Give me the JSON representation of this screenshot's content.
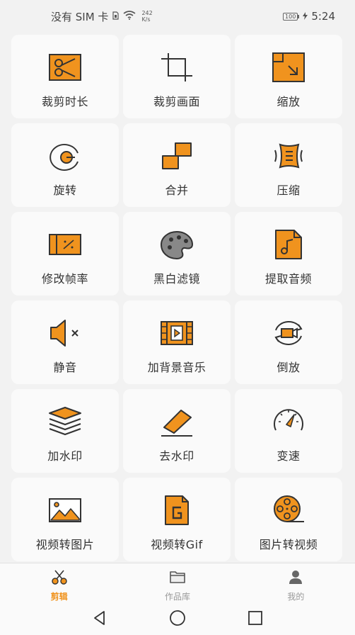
{
  "status_bar": {
    "carrier": "没有 SIM 卡",
    "net_speed_value": "242",
    "net_speed_unit": "K/s",
    "battery": "100",
    "time": "5:24"
  },
  "colors": {
    "accent": "#f0931e",
    "icon_stroke": "#333333",
    "tile_bg": "#fafafa"
  },
  "tools": [
    {
      "label": "裁剪时长",
      "icon": "scissors-icon"
    },
    {
      "label": "裁剪画面",
      "icon": "crop-icon"
    },
    {
      "label": "缩放",
      "icon": "scale-icon"
    },
    {
      "label": "旋转",
      "icon": "rotate-icon"
    },
    {
      "label": "合并",
      "icon": "merge-icon"
    },
    {
      "label": "压缩",
      "icon": "compress-icon"
    },
    {
      "label": "修改帧率",
      "icon": "framerate-icon"
    },
    {
      "label": "黑白滤镜",
      "icon": "palette-icon"
    },
    {
      "label": "提取音频",
      "icon": "audio-file-icon"
    },
    {
      "label": "静音",
      "icon": "mute-icon"
    },
    {
      "label": "加背景音乐",
      "icon": "bgm-icon"
    },
    {
      "label": "倒放",
      "icon": "reverse-icon"
    },
    {
      "label": "加水印",
      "icon": "layers-icon"
    },
    {
      "label": "去水印",
      "icon": "eraser-icon"
    },
    {
      "label": "变速",
      "icon": "speedometer-icon"
    },
    {
      "label": "视频转图片",
      "icon": "image-icon"
    },
    {
      "label": "视频转Gif",
      "icon": "gif-file-icon"
    },
    {
      "label": "图片转视频",
      "icon": "film-reel-icon"
    }
  ],
  "bottom_nav": [
    {
      "label": "剪辑",
      "icon": "scissors-nav-icon",
      "active": true
    },
    {
      "label": "作品库",
      "icon": "folder-icon",
      "active": false
    },
    {
      "label": "我的",
      "icon": "person-icon",
      "active": false
    }
  ]
}
